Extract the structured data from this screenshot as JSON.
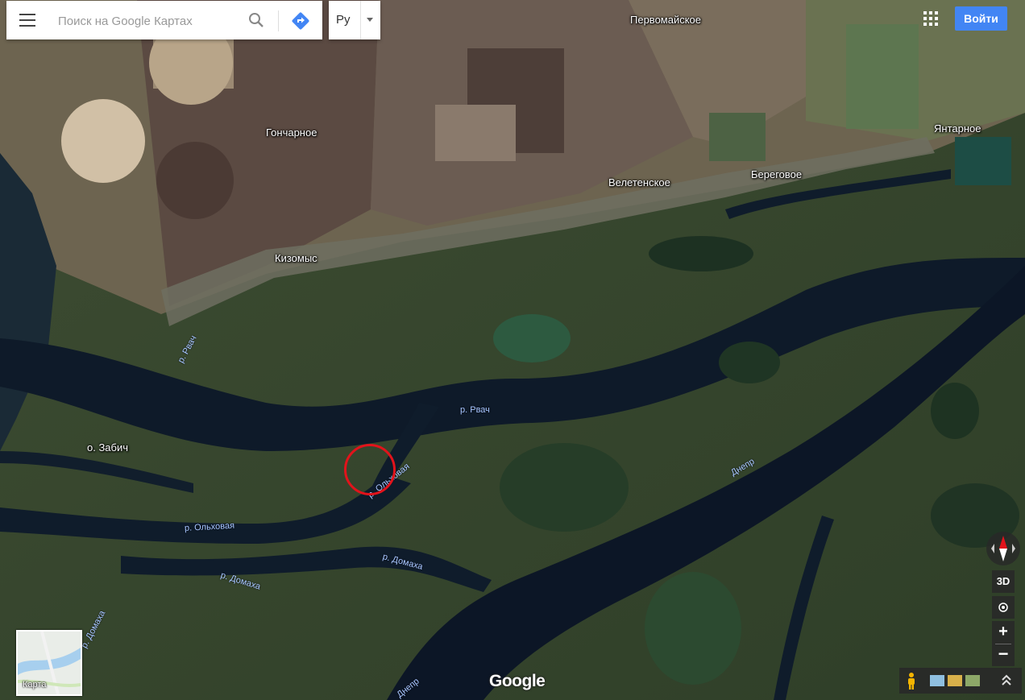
{
  "search": {
    "placeholder": "Поиск на Google Картах",
    "value": ""
  },
  "language": {
    "label": "Ру"
  },
  "account": {
    "signin_label": "Войти"
  },
  "places": {
    "pervomayskoe": "Первомайское",
    "goncharnoe": "Гончарное",
    "yantarnoe": "Янтарное",
    "veletenskoe": "Велетенское",
    "beregovoe": "Береговое",
    "kizomys": "Кизомыс",
    "zabich": "о. Забич"
  },
  "rivers": {
    "rvach_1": "р. Рвач",
    "rvach_2": "р. Рвач",
    "olkhovaya_1": "р. Ольховая",
    "olkhovaya_2": "р. Ольховая",
    "domakha_1": "р. Домаха",
    "domakha_2": "р. Домаха",
    "domakha_3": "р. Домаха",
    "dnepr_1": "Днепр",
    "dnepr_2": "Днепр"
  },
  "controls": {
    "btn_3d": "3D",
    "zoom_in": "+",
    "zoom_out": "−"
  },
  "minimap": {
    "label": "Карта"
  },
  "logo": "Google",
  "colors": {
    "marker": "#e2131b",
    "signin_bg": "#4285f4",
    "water": "#0f1a2a",
    "land": "#3a4a2e"
  },
  "icons": [
    "menu-icon",
    "search-icon",
    "directions-icon",
    "apps-grid-icon",
    "compass-icon",
    "my-location-icon",
    "pegman-icon",
    "expand-icon"
  ]
}
